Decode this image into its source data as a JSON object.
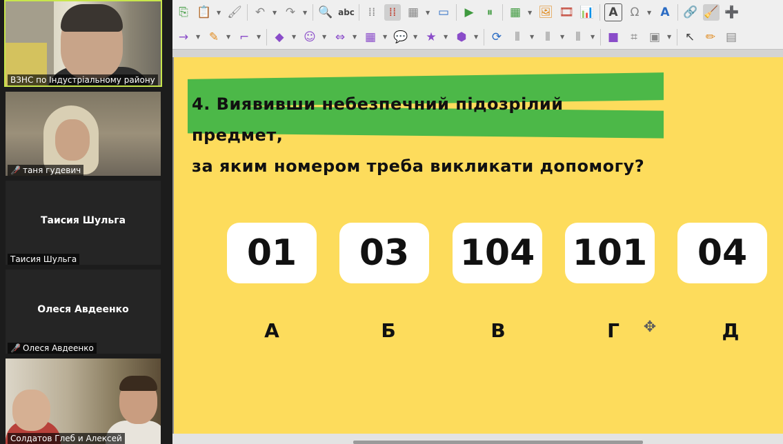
{
  "participants": [
    {
      "name": "ВЗНС по Індустріальному району",
      "muted": false,
      "video": true,
      "active": true
    },
    {
      "name": "таня гудевич",
      "muted": true,
      "video": true,
      "active": false
    },
    {
      "name": "Таисия Шульга",
      "display_name": "Таисия Шульга",
      "muted": false,
      "video": false,
      "active": false
    },
    {
      "name": "Олеся Авдеенко",
      "display_name": "Олеся Авдеенко",
      "muted": true,
      "video": false,
      "active": false
    },
    {
      "name": "Солдатов Глеб и Алексей",
      "muted": false,
      "video": true,
      "active": false
    }
  ],
  "icons": {
    "mic_off": "🎤",
    "row1": [
      "⎘",
      "📋",
      "🖌",
      "↶",
      "↷",
      "🔍",
      "abc",
      "⁞⁞",
      "⁞⁞",
      "▦",
      "▭",
      "▶",
      "⏸",
      "▦",
      "🖼",
      "🎞",
      "📊",
      "A",
      "Ω",
      "A",
      "🔗",
      "🧹",
      "➕"
    ],
    "row2": [
      "→",
      "✎",
      "⌐",
      "◆",
      "☺",
      "⇔",
      "▦",
      "💬",
      "★",
      "⬢",
      "⟳",
      "⫴",
      "⫴",
      "⫴",
      "■",
      "⌗",
      "▣",
      "↖",
      "✏",
      "▤"
    ]
  },
  "slide": {
    "question_line1": "4. Виявивши небезпечний підозрілий",
    "question_line2": "предмет,",
    "question_line3": "за яким номером треба викликати допомогу?",
    "options": [
      {
        "number": "01",
        "letter": "А"
      },
      {
        "number": "03",
        "letter": "Б"
      },
      {
        "number": "104",
        "letter": "В"
      },
      {
        "number": "101",
        "letter": "Г"
      },
      {
        "number": "04",
        "letter": "Д"
      }
    ],
    "move_cursor_glyph": "✥"
  },
  "colors": {
    "slide_background": "#fddc5c",
    "highlight_green": "#4cb848",
    "active_speaker_border": "#c8e64b",
    "muted_red": "#e53935"
  }
}
